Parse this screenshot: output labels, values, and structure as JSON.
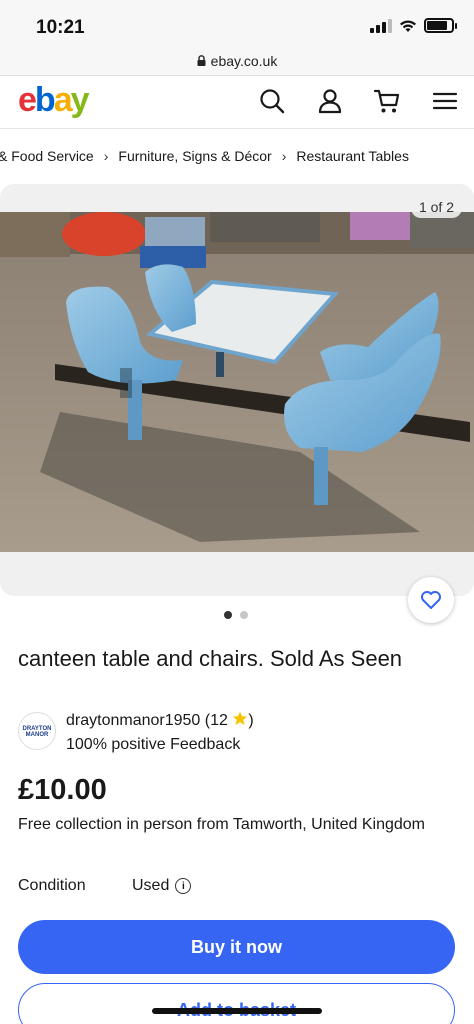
{
  "status": {
    "time": "10:21"
  },
  "browser": {
    "url": "ebay.co.uk"
  },
  "header": {
    "logo": {
      "e": "e",
      "b": "b",
      "a": "a",
      "y": "y"
    },
    "icons": [
      "search-icon",
      "account-icon",
      "cart-icon",
      "menu-icon"
    ]
  },
  "breadcrumb": {
    "items": [
      "& Food Service",
      "Furniture, Signs & Décor",
      "Restaurant Tables"
    ],
    "separator": "›"
  },
  "gallery": {
    "counter": "1 of 2",
    "current": 1,
    "total": 2
  },
  "listing": {
    "title": "canteen table and chairs.  Sold As Seen",
    "seller": {
      "name": "draytonmanor1950 (12",
      "name_suffix": ")",
      "feedback": "100% positive Feedback",
      "avatar_text": "DRAYTON MANOR"
    },
    "price": "£10.00",
    "shipping": "Free collection in person from Tamworth, United Kingdom",
    "condition_label": "Condition",
    "condition_value": "Used"
  },
  "actions": {
    "buy_now": "Buy it now",
    "add_to_basket": "Add to basket"
  },
  "colors": {
    "accent": "#3665f3",
    "logo_e": "#e53238",
    "logo_b": "#0064d2",
    "logo_a": "#f5af02",
    "logo_y": "#86b817"
  }
}
